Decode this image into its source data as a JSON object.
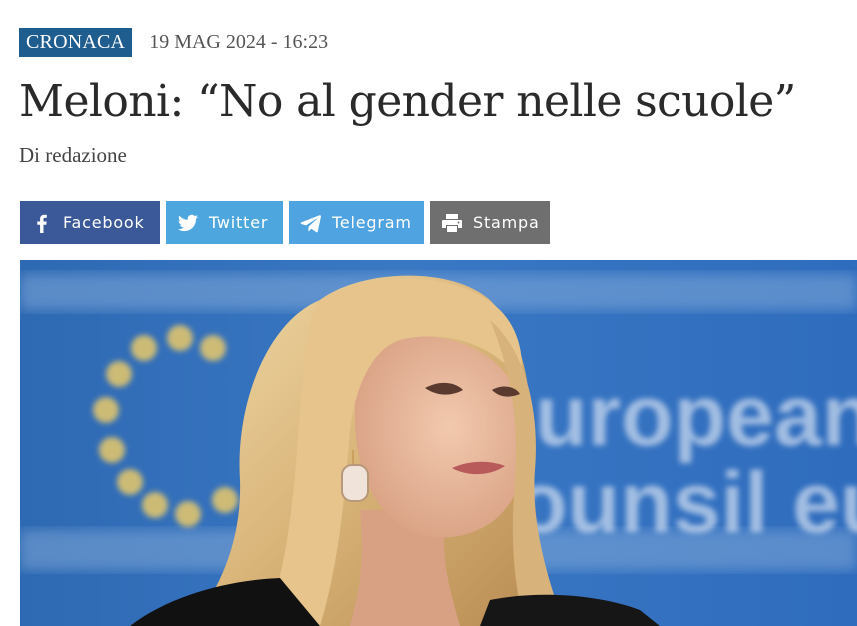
{
  "article": {
    "category": "CRONACA",
    "date": "19 MAG 2024 - 16:23",
    "title": "Meloni: “No al gender nelle scuole”",
    "byline": "Di redazione"
  },
  "share": {
    "facebook": {
      "label": "Facebook",
      "icon": "facebook-icon",
      "color": "#3b5998"
    },
    "twitter": {
      "label": "Twitter",
      "icon": "twitter-icon",
      "color": "#4da7de"
    },
    "telegram": {
      "label": "Telegram",
      "icon": "telegram-icon",
      "color": "#4fa3e0"
    },
    "print": {
      "label": "Stampa",
      "icon": "printer-icon",
      "color": "#6f6f6f"
    }
  },
  "image": {
    "background_text": "European Council"
  },
  "colors": {
    "category_bg": "#1f5d8f",
    "title": "#2a2a2a"
  }
}
